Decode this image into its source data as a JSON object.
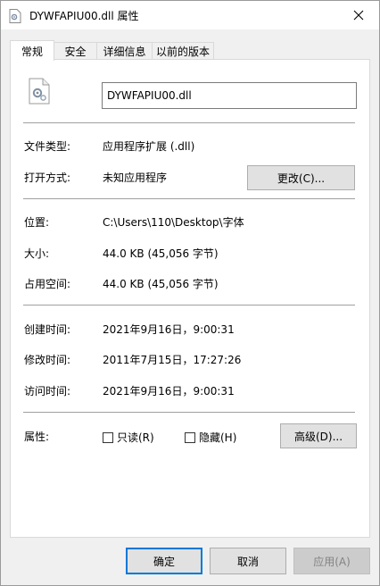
{
  "window": {
    "title": "DYWFAPIU00.dll 属性",
    "close_icon": "close-icon",
    "dll_icon": "dll-file-icon"
  },
  "tabs": [
    {
      "label": "常规",
      "active": true
    },
    {
      "label": "安全",
      "active": false
    },
    {
      "label": "详细信息",
      "active": false
    },
    {
      "label": "以前的版本",
      "active": false
    }
  ],
  "general": {
    "file_name": "DYWFAPIU00.dll",
    "file_type_label": "文件类型:",
    "file_type_value": "应用程序扩展 (.dll)",
    "opens_with_label": "打开方式:",
    "opens_with_value": "未知应用程序",
    "change_button": "更改(C)...",
    "location_label": "位置:",
    "location_value": "C:\\Users\\110\\Desktop\\字体",
    "size_label": "大小:",
    "size_value": "44.0 KB (45,056 字节)",
    "size_on_disk_label": "占用空间:",
    "size_on_disk_value": "44.0 KB (45,056 字节)",
    "created_label": "创建时间:",
    "created_value": "2021年9月16日，9:00:31",
    "modified_label": "修改时间:",
    "modified_value": "2011年7月15日，17:27:26",
    "accessed_label": "访问时间:",
    "accessed_value": "2021年9月16日，9:00:31",
    "attributes_label": "属性:",
    "readonly_label": "只读(R)",
    "readonly_checked": false,
    "hidden_label": "隐藏(H)",
    "hidden_checked": false,
    "advanced_button": "高级(D)..."
  },
  "footer": {
    "ok": "确定",
    "cancel": "取消",
    "apply": "应用(A)"
  }
}
